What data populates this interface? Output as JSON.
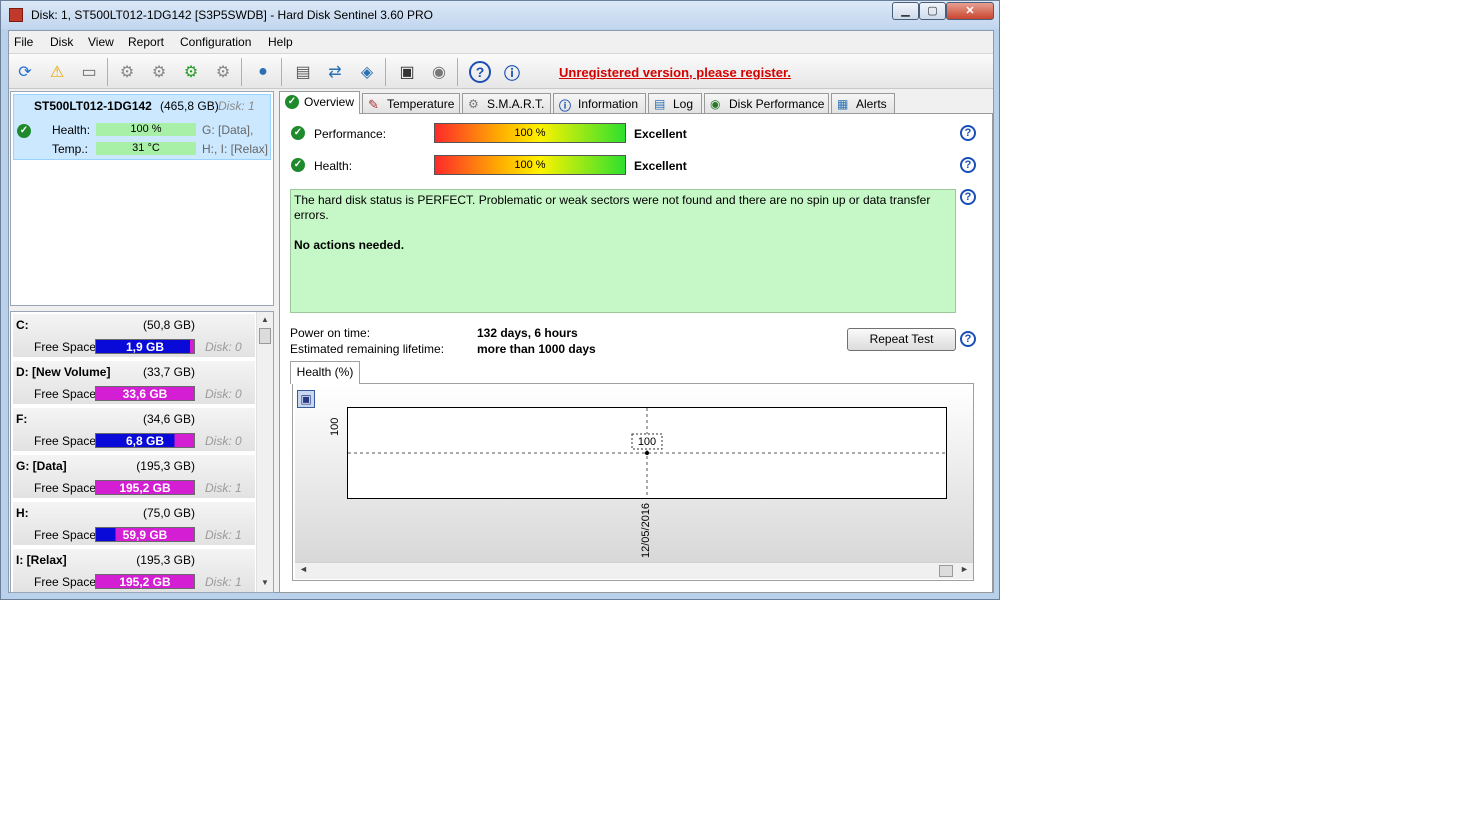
{
  "window": {
    "title": "Disk: 1, ST500LT012-1DG142 [S3P5SWDB]  -  Hard Disk Sentinel 3.60 PRO",
    "minimize": "▁",
    "maximize": "▢",
    "close": "✕"
  },
  "menu": [
    "File",
    "Disk",
    "View",
    "Report",
    "Configuration",
    "Help"
  ],
  "toolbar": {
    "unregistered": "Unregistered version, please register.",
    "icons": [
      "refresh-icon",
      "alert-icon",
      "disk-drive-icon",
      "disk-test-1-icon",
      "disk-test-2-icon",
      "disk-test-3-icon",
      "disk-test-4-icon",
      "globe-icon",
      "report-icon",
      "sync-icon",
      "network-icon",
      "terminal-icon",
      "speaker-icon",
      "help-icon",
      "info-icon"
    ]
  },
  "disk": {
    "name": "ST500LT012-1DG142",
    "size": "(465,8 GB)",
    "disk_label": "Disk: 1",
    "health_label": "Health:",
    "health_value": "100 %",
    "health_drives": "G: [Data],",
    "temp_label": "Temp.:",
    "temp_value": "31 °C",
    "temp_drives": "H:, I: [Relax]"
  },
  "volumes": [
    {
      "name": "C:",
      "size": "(50,8 GB)",
      "free_label": "Free Space",
      "free": "1,9 GB",
      "used_fraction": 0.96,
      "disk": "Disk: 0"
    },
    {
      "name": "D: [New Volume]",
      "size": "(33,7 GB)",
      "free_label": "Free Space",
      "free": "33,6 GB",
      "used_fraction": 0.0,
      "disk": "Disk: 0"
    },
    {
      "name": "F:",
      "size": "(34,6 GB)",
      "free_label": "Free Space",
      "free": "6,8 GB",
      "used_fraction": 0.8,
      "disk": "Disk: 0"
    },
    {
      "name": "G: [Data]",
      "size": "(195,3 GB)",
      "free_label": "Free Space",
      "free": "195,2 GB",
      "used_fraction": 0.0,
      "disk": "Disk: 1"
    },
    {
      "name": "H:",
      "size": "(75,0 GB)",
      "free_label": "Free Space",
      "free": "59,9 GB",
      "used_fraction": 0.2,
      "disk": "Disk: 1"
    },
    {
      "name": "I: [Relax]",
      "size": "(195,3 GB)",
      "free_label": "Free Space",
      "free": "195,2 GB",
      "used_fraction": 0.0,
      "disk": "Disk: 1"
    }
  ],
  "tabs": [
    "Overview",
    "Temperature",
    "S.M.A.R.T.",
    "Information",
    "Log",
    "Disk Performance",
    "Alerts"
  ],
  "overview": {
    "performance_label": "Performance:",
    "performance_value": "100 %",
    "performance_rating": "Excellent",
    "health_label": "Health:",
    "health_value": "100 %",
    "health_rating": "Excellent",
    "status_text": "The hard disk status is PERFECT. Problematic or weak sectors were not found and there are no spin up or data transfer errors.",
    "status_action": "No actions needed.",
    "power_on_label": "Power on time:",
    "power_on_value": "132 days, 6 hours",
    "lifetime_label": "Estimated remaining lifetime:",
    "lifetime_value": "more than 1000 days",
    "repeat_test": "Repeat Test",
    "chart_tab": "Health (%)",
    "help": "?"
  },
  "chart_data": {
    "type": "line",
    "x": [
      "12/05/2016"
    ],
    "series": [
      {
        "values": [
          100
        ]
      }
    ],
    "y_tick_labels": [
      "100"
    ],
    "data_labels": [
      "100"
    ],
    "grid": true
  },
  "colors": {
    "free_space_fill": "#0a0ad8",
    "used_space_fill": "#d41ed4",
    "status_bg": "#c6f7c6",
    "accent_red": "#d50000"
  }
}
